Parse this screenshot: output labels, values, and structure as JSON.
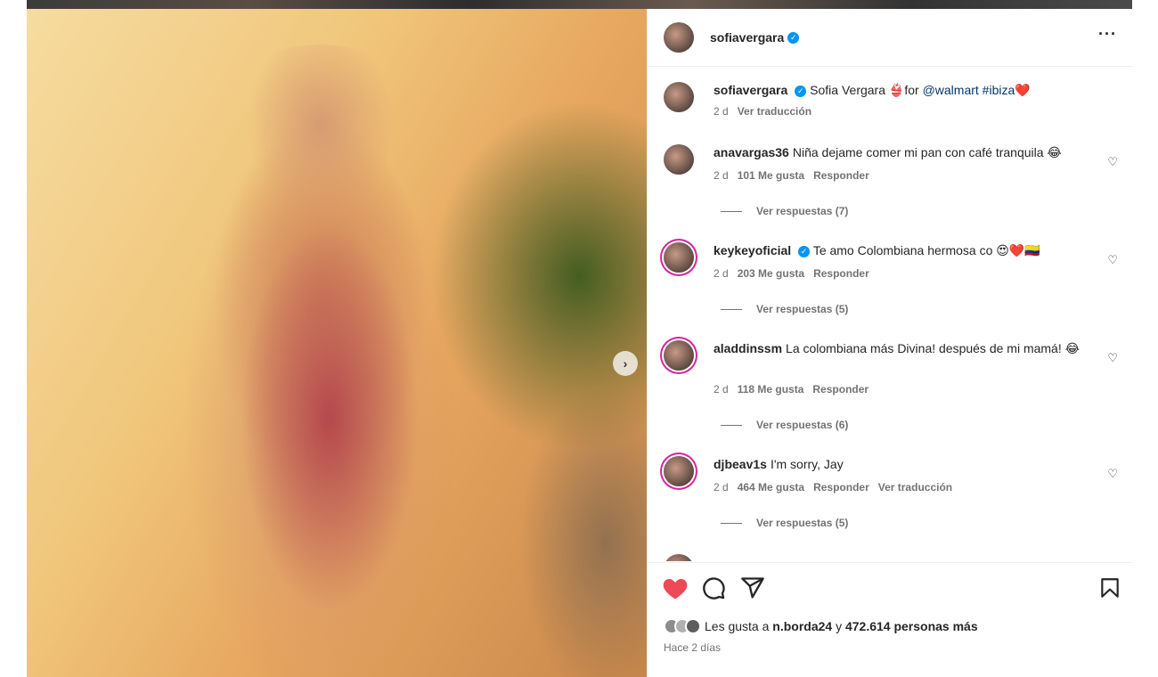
{
  "post": {
    "username": "sofiavergara",
    "verified": true,
    "caption": {
      "text_pre": "Sofia Vergara 👙for ",
      "mention": "@walmart",
      "hashtag": "#ibiza",
      "emoji": "❤️",
      "time": "2 d",
      "translate": "Ver traducción"
    }
  },
  "comments": [
    {
      "username": "anavargas36",
      "verified": false,
      "text": "Niña dejame comer mi pan con café tranquila 😂",
      "time": "2 d",
      "likes": "101 Me gusta",
      "reply": "Responder",
      "view_replies": "Ver respuestas (7)"
    },
    {
      "username": "keykeyoficial",
      "verified": true,
      "text": "Te amo Colombiana hermosa co 😍❤️🇨🇴",
      "time": "2 d",
      "likes": "203 Me gusta",
      "reply": "Responder",
      "view_replies": "Ver respuestas (5)"
    },
    {
      "username": "aladdinssm",
      "verified": false,
      "text": "La colombiana más Divina! después de mi mamá! 😂",
      "time": "2 d",
      "likes": "118 Me gusta",
      "reply": "Responder",
      "view_replies": "Ver respuestas (6)"
    },
    {
      "username": "djbeav1s",
      "verified": false,
      "text": "I'm sorry, Jay",
      "time": "2 d",
      "likes": "464 Me gusta",
      "reply": "Responder",
      "translate": "Ver traducción",
      "view_replies": "Ver respuestas (5)"
    }
  ],
  "likes_summary": {
    "prefix": "Les gusta a ",
    "user": "n.borda24",
    "middle": " y ",
    "count": "472.614 personas más"
  },
  "posted_ago": "Hace 2 días",
  "colors": {
    "like_red": "#ed4956",
    "link": "#00376b",
    "verified": "#0095f6",
    "meta": "#737373"
  },
  "icons": [
    "more-icon",
    "heart-icon",
    "comment-icon",
    "share-icon",
    "bookmark-icon",
    "chevron-right-icon",
    "verified-badge-icon"
  ]
}
